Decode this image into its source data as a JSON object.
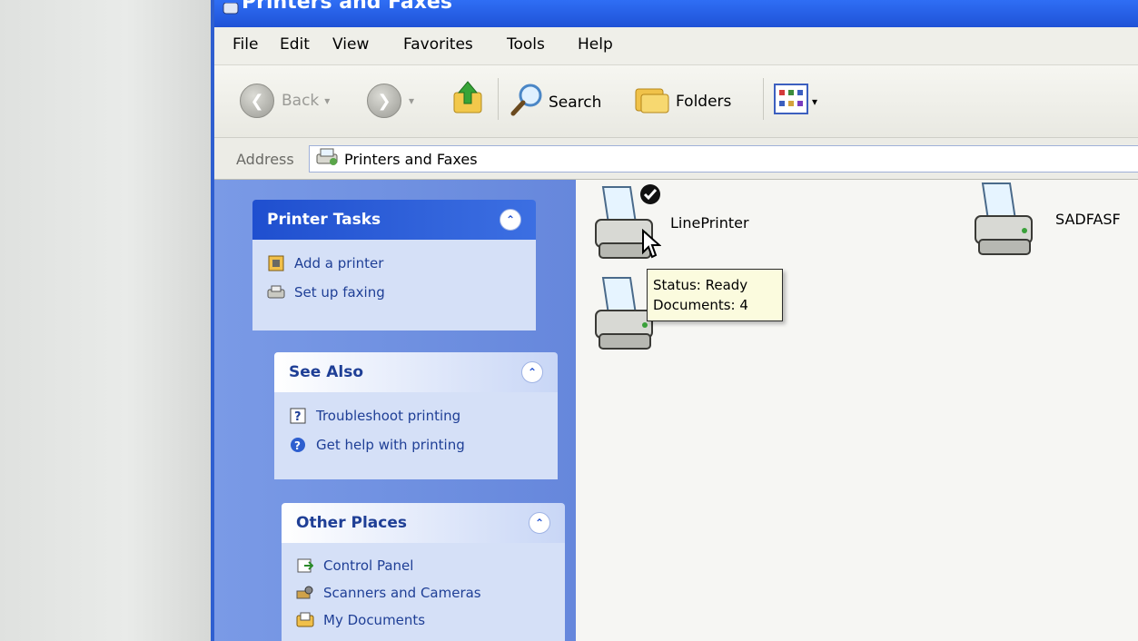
{
  "window": {
    "title": "Printers and Faxes"
  },
  "menu": [
    "File",
    "Edit",
    "View",
    "Favorites",
    "Tools",
    "Help"
  ],
  "toolbar": {
    "back_label": "Back",
    "search_label": "Search",
    "folders_label": "Folders"
  },
  "address": {
    "label": "Address",
    "value": "Printers and Faxes"
  },
  "taskpane": {
    "printer_tasks": {
      "title": "Printer Tasks",
      "items": [
        "Add a printer",
        "Set up faxing"
      ]
    },
    "see_also": {
      "title": "See Also",
      "items": [
        "Troubleshoot printing",
        "Get help with printing"
      ]
    },
    "other_places": {
      "title": "Other Places",
      "items": [
        "Control Panel",
        "Scanners and Cameras",
        "My Documents"
      ]
    }
  },
  "printers": [
    {
      "name": "LinePrinter",
      "default": true
    },
    {
      "name": "SADFASF",
      "default": false
    },
    {
      "name": "",
      "default": false
    }
  ],
  "tooltip": {
    "status": "Status: Ready",
    "documents": "Documents: 4"
  },
  "colors": {
    "title_blue": "#1f52d6",
    "taskpane_blue": "#6e8fe0",
    "panel_header_blue": "#1f4fcf",
    "tooltip_bg": "#fbfbde"
  }
}
